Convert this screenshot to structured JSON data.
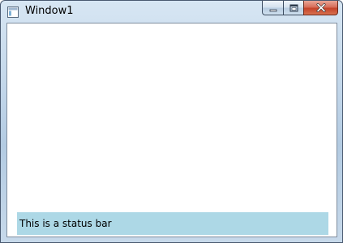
{
  "window": {
    "title": "Window1",
    "icon": "app-window-icon",
    "controls": {
      "minimize_icon": "minimize-icon",
      "maximize_icon": "maximize-icon",
      "close_icon": "close-icon"
    }
  },
  "statusbar": {
    "text": "This is a status bar",
    "background": "#add8e6"
  }
}
